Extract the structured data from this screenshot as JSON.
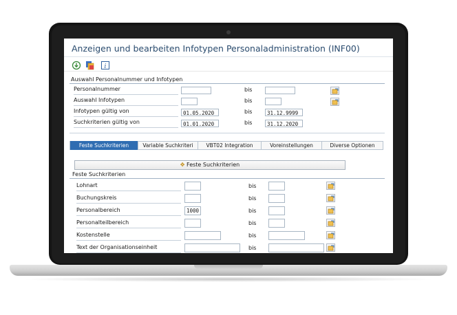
{
  "window": {
    "title": "Anzeigen und bearbeiten Infotypen Personaladministration (INF00)"
  },
  "toolbar": {
    "icons": [
      "execute-icon",
      "variant-icon",
      "info-icon"
    ]
  },
  "selection": {
    "title": "Auswahl Personalnummer und Infotypen",
    "rows": [
      {
        "label": "Personalnummer",
        "from": "",
        "bis": "bis",
        "to": ""
      },
      {
        "label": "Auswahl Infotypen",
        "from": "",
        "bis": "bis",
        "to": ""
      },
      {
        "label": "Infotypen  gültig von",
        "from": "01.05.2020",
        "bis": "bis",
        "to": "31.12.9999"
      },
      {
        "label": "Suchkriterien gültig von",
        "from": "01.01.2020",
        "bis": "bis",
        "to": "31.12.2020"
      }
    ]
  },
  "tabs": [
    "Feste Suchkriterien",
    "Variable Suchkriteri",
    "VBT02 Integration",
    "Voreinstellungen",
    "Diverse Optionen"
  ],
  "feste": {
    "button_label": "Feste Suchkriterien",
    "title": "Feste Suchkriterien",
    "rows": [
      {
        "label": "Lohnart",
        "from": "",
        "bis": "bis",
        "to": ""
      },
      {
        "label": "Buchungskreis",
        "from": "",
        "bis": "bis",
        "to": ""
      },
      {
        "label": "Personalbereich",
        "from": "1000",
        "bis": "bis",
        "to": ""
      },
      {
        "label": "Personalteilbereich",
        "from": "",
        "bis": "bis",
        "to": ""
      },
      {
        "label": "Kostenstelle",
        "from": "",
        "bis": "bis",
        "to": ""
      },
      {
        "label": "Text der Organisationseinheit",
        "from": "",
        "bis": "bis",
        "to": ""
      }
    ]
  }
}
